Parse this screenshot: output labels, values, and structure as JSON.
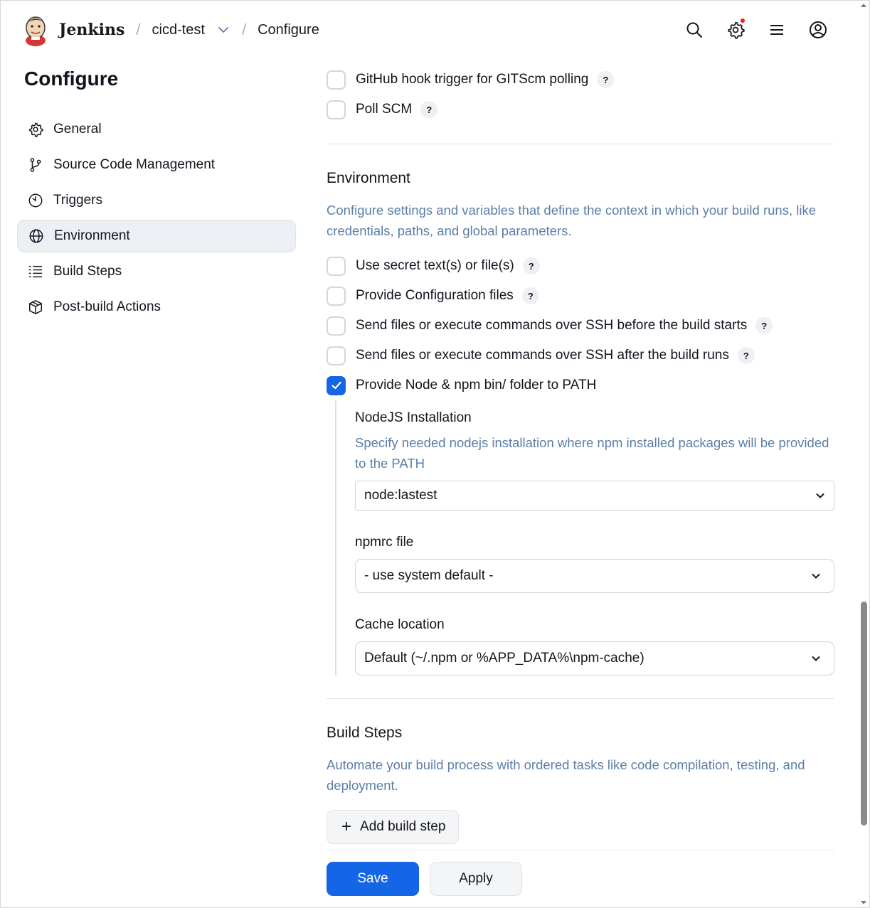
{
  "header": {
    "brand": "Jenkins",
    "breadcrumbs": [
      "cicd-test",
      "Configure"
    ],
    "separator": "/",
    "icons": [
      "search-icon",
      "settings-icon",
      "menu-icon",
      "account-icon"
    ],
    "notification_color": "#e5202a"
  },
  "sidebar": {
    "title": "Configure",
    "items": [
      {
        "label": "General",
        "icon": "gear-icon"
      },
      {
        "label": "Source Code Management",
        "icon": "branch-icon"
      },
      {
        "label": "Triggers",
        "icon": "timer-icon"
      },
      {
        "label": "Environment",
        "icon": "globe-icon",
        "active": true
      },
      {
        "label": "Build Steps",
        "icon": "list-icon"
      },
      {
        "label": "Post-build Actions",
        "icon": "package-icon"
      }
    ]
  },
  "triggers": {
    "options": [
      {
        "label": "GitHub hook trigger for GITScm polling",
        "checked": false,
        "help": "?"
      },
      {
        "label": "Poll SCM",
        "checked": false,
        "help": "?"
      }
    ]
  },
  "environment": {
    "title": "Environment",
    "description": "Configure settings and variables that define the context in which your build runs, like credentials, paths, and global parameters.",
    "options": [
      {
        "label": "Use secret text(s) or file(s)",
        "checked": false,
        "help": "?"
      },
      {
        "label": "Provide Configuration files",
        "checked": false,
        "help": "?"
      },
      {
        "label": "Send files or execute commands over SSH before the build starts",
        "checked": false,
        "help": "?"
      },
      {
        "label": "Send files or execute commands over SSH after the build runs",
        "checked": false,
        "help": "?"
      },
      {
        "label": "Provide Node & npm bin/ folder to PATH",
        "checked": true
      }
    ],
    "node": {
      "installation_label": "NodeJS Installation",
      "installation_desc": "Specify needed nodejs installation where npm installed packages will be provided to the PATH",
      "installation_value": "node:lastest",
      "npmrc_label": "npmrc file",
      "npmrc_value": "- use system default -",
      "cache_label": "Cache location",
      "cache_value": "Default (~/.npm or %APP_DATA%\\npm-cache)"
    }
  },
  "build_steps": {
    "title": "Build Steps",
    "description": "Automate your build process with ordered tasks like code compilation, testing, and deployment.",
    "add_label": "Add build step",
    "add_icon": "+"
  },
  "actions": {
    "save": "Save",
    "apply": "Apply",
    "accent": "#1466e6"
  }
}
